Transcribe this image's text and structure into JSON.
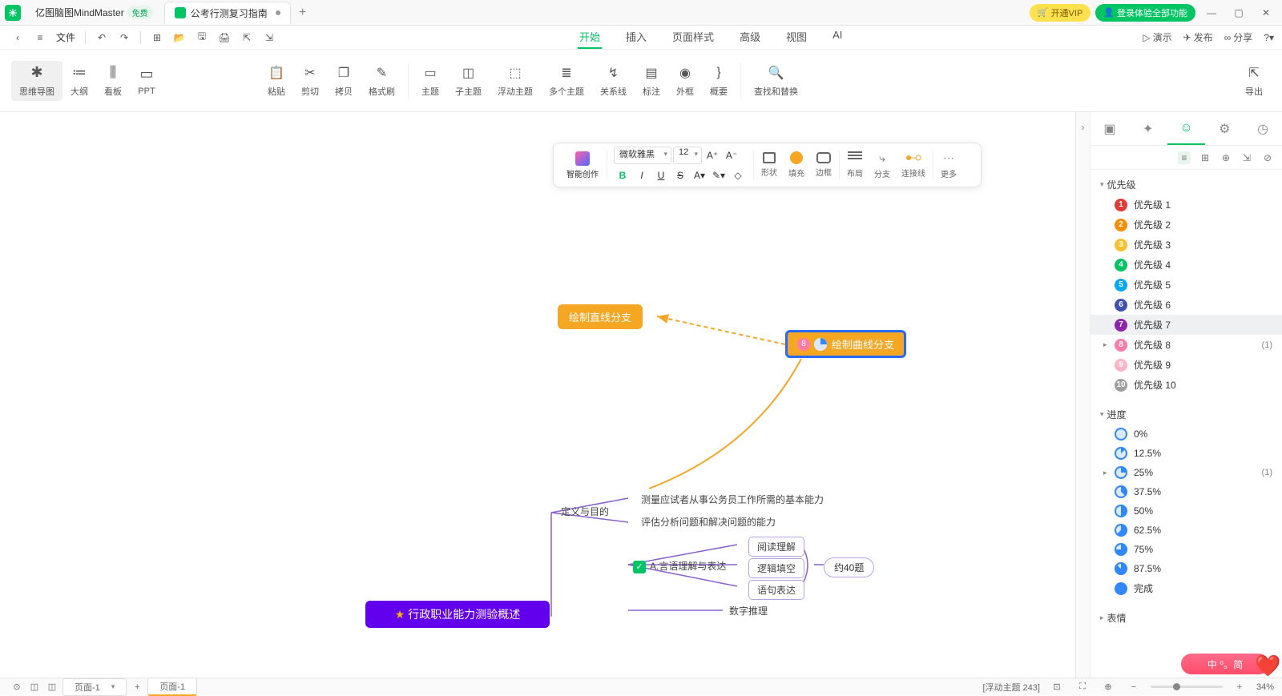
{
  "titlebar": {
    "app_name": "亿图脑图MindMaster",
    "free_label": "免费",
    "doc_tab": "公考行测复习指南",
    "vip_label": "开通VIP",
    "login_label": "登录体验全部功能"
  },
  "quickbar": {
    "file_label": "文件"
  },
  "menubar": {
    "items": [
      "开始",
      "插入",
      "页面样式",
      "高级",
      "视图",
      "AI"
    ],
    "right": {
      "present": "演示",
      "publish": "发布",
      "share": "分享"
    }
  },
  "ribbon": {
    "view": {
      "mindmap": "思维导图",
      "outline": "大纲",
      "kanban": "看板",
      "ppt": "PPT"
    },
    "clip": {
      "paste": "粘贴",
      "cut": "剪切",
      "copy": "拷贝",
      "format": "格式刷"
    },
    "topic": {
      "topic": "主题",
      "subtopic": "子主题",
      "float": "浮动主题",
      "multi": "多个主题",
      "relation": "关系线",
      "callout": "标注",
      "boundary": "外框",
      "summary": "概要",
      "find": "查找和替换"
    },
    "export": "导出"
  },
  "floatbar": {
    "ai": "智能创作",
    "font": "微软雅黑",
    "size": "12",
    "shape": "形状",
    "fill": "填充",
    "border": "边框",
    "layout": "布局",
    "branch": "分支",
    "connector": "连接线",
    "more": "更多"
  },
  "canvas": {
    "node_line": "绘制直线分支",
    "node_curve": "绘制曲线分支",
    "def": "定义与目的",
    "def_a": "测量应试者从事公务员工作所需的基本能力",
    "def_b": "评估分析问题和解决问题的能力",
    "sec_a": "A.言语理解与表达",
    "sub_a1": "阅读理解",
    "sub_a2": "逻辑填空",
    "sub_a3": "语句表达",
    "count_a": "约40题",
    "sec_b": "数字推理",
    "root": "行政职业能力测验概述"
  },
  "panel": {
    "priority_head": "优先级",
    "priority": [
      {
        "n": "1",
        "label": "优先级 1",
        "color": "#e53935"
      },
      {
        "n": "2",
        "label": "优先级 2",
        "color": "#fb8c00"
      },
      {
        "n": "3",
        "label": "优先级 3",
        "color": "#fbc02d"
      },
      {
        "n": "4",
        "label": "优先级 4",
        "color": "#00c562"
      },
      {
        "n": "5",
        "label": "优先级 5",
        "color": "#03a9f4"
      },
      {
        "n": "6",
        "label": "优先级 6",
        "color": "#3f51b5"
      },
      {
        "n": "7",
        "label": "优先级 7",
        "color": "#8e24aa"
      },
      {
        "n": "8",
        "label": "优先级 8",
        "color": "#ff7aa8",
        "count": "(1)",
        "expand": true
      },
      {
        "n": "9",
        "label": "优先级 9",
        "color": "#ffb3c7"
      },
      {
        "n": "10",
        "label": "优先级 10",
        "color": "#9e9e9e"
      }
    ],
    "progress_head": "进度",
    "progress": [
      {
        "label": "0%",
        "deg": 0
      },
      {
        "label": "12.5%",
        "deg": 45
      },
      {
        "label": "25%",
        "deg": 90,
        "count": "(1)",
        "expand": true
      },
      {
        "label": "37.5%",
        "deg": 135
      },
      {
        "label": "50%",
        "deg": 180
      },
      {
        "label": "62.5%",
        "deg": 225
      },
      {
        "label": "75%",
        "deg": 270
      },
      {
        "label": "87.5%",
        "deg": 315
      },
      {
        "label": "完成",
        "deg": 360
      }
    ],
    "emoji_head": "表情"
  },
  "statusbar": {
    "page_sel": "页面-1",
    "page_tab": "页面-1",
    "float_info": "[浮动主题 243]",
    "zoom": "34%"
  },
  "ime": "中 ⁰。简"
}
